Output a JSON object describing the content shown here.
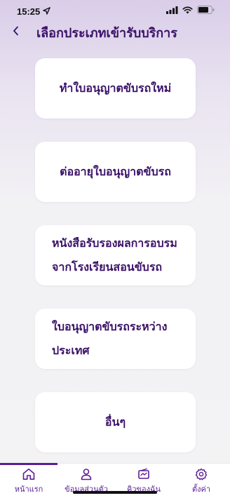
{
  "status": {
    "time": "15:25",
    "icons": [
      "location-arrow-icon",
      "signal-icon",
      "wifi-icon",
      "battery-icon"
    ]
  },
  "header": {
    "title": "เลือกประเภทเข้ารับบริการ",
    "back_icon": "chevron-left-icon"
  },
  "services": [
    {
      "label": "ทำใบอนุญาตขับรถใหม่"
    },
    {
      "label": "ต่ออายุใบอนุญาตขับรถ"
    },
    {
      "label_line1": "หนังสือรับรองผลการอบรม",
      "label_line2": "จากโรงเรียนสอนขับรถ"
    },
    {
      "label_line1": "ใบอนุญาตขับรถระหว่าง",
      "label_line2": "ประเทศ"
    },
    {
      "label": "อื่นๆ"
    }
  ],
  "tabs": [
    {
      "label": "หน้าแรก",
      "icon": "home-icon",
      "active": true
    },
    {
      "label": "ข้อมูลส่วนตัว",
      "icon": "user-icon",
      "active": false
    },
    {
      "label": "คิวของฉัน",
      "icon": "ticket-icon",
      "active": false
    },
    {
      "label": "ตั้งค่า",
      "icon": "gear-icon",
      "active": false
    }
  ],
  "colors": {
    "primary": "#3b1268",
    "accent": "#5a1d96",
    "card_bg": "#ffffff"
  }
}
